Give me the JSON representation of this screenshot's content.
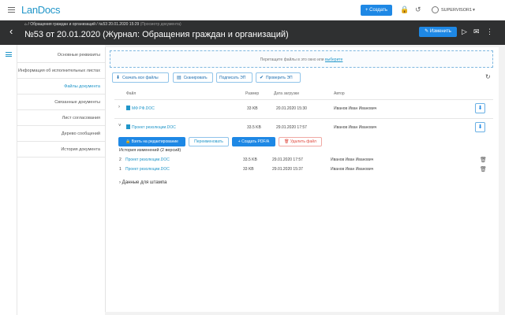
{
  "app": {
    "logo_text": "LanDocs",
    "create_label": "+ Создать",
    "user_name": "SUPERVISOR1"
  },
  "header": {
    "breadcrumbs": [
      "Обращения граждан и организаций",
      "№53 20.01.2020 15:29",
      "(Просмотр документа)"
    ],
    "title": "№53 от 20.01.2020 (Журнал: Обращения граждан и организаций)",
    "edit_label": "Изменить"
  },
  "nav": {
    "items": [
      {
        "label": "Основные реквизиты"
      },
      {
        "label": "Информация об исполнительных листах"
      },
      {
        "label": "Файлы документа"
      },
      {
        "label": "Связанные документы"
      },
      {
        "label": "Лист согласования"
      },
      {
        "label": "Дерево сообщений"
      },
      {
        "label": "История документа"
      }
    ]
  },
  "dropzone": {
    "text": "Перетащите файлы в это окно или",
    "link": "выберите"
  },
  "toolbar": {
    "download_all": "Скачать все файлы",
    "scan": "Сканировать",
    "sign": "Подписать ЭП",
    "verify": "Проверить ЭП"
  },
  "table": {
    "columns": [
      "Файл",
      "Размер",
      "Дата загрузки",
      "Автор"
    ],
    "rows": [
      {
        "name": "МФ РФ.DOC",
        "size": "33 KB",
        "date": "20.01.2020 15:30",
        "author": "Иванов Иван Иванович"
      },
      {
        "name": "Проект резолюции.DOC",
        "size": "33.5 KB",
        "date": "29.01.2020 17:57",
        "author": "Иванов Иван Иванович"
      }
    ]
  },
  "actions": {
    "take_edit": "Взять на редактирование",
    "rename": "Переименовать",
    "create_pdf": "+ Создать PDF/A",
    "delete": "Удалить файл"
  },
  "history": {
    "title": "История изменений (2 версий)",
    "rows": [
      {
        "num": "2",
        "name": "Проект резолюции.DOC",
        "size": "33.5 KB",
        "date": "29.01.2020 17:57",
        "author": "Иванов Иван Иванович"
      },
      {
        "num": "1",
        "name": "Проект резолюции.DOC",
        "size": "33 KB",
        "date": "29.01.2020 15:37",
        "author": "Иванов Иван Иванович"
      }
    ]
  },
  "stamp": {
    "label": "Данные для штампа"
  }
}
